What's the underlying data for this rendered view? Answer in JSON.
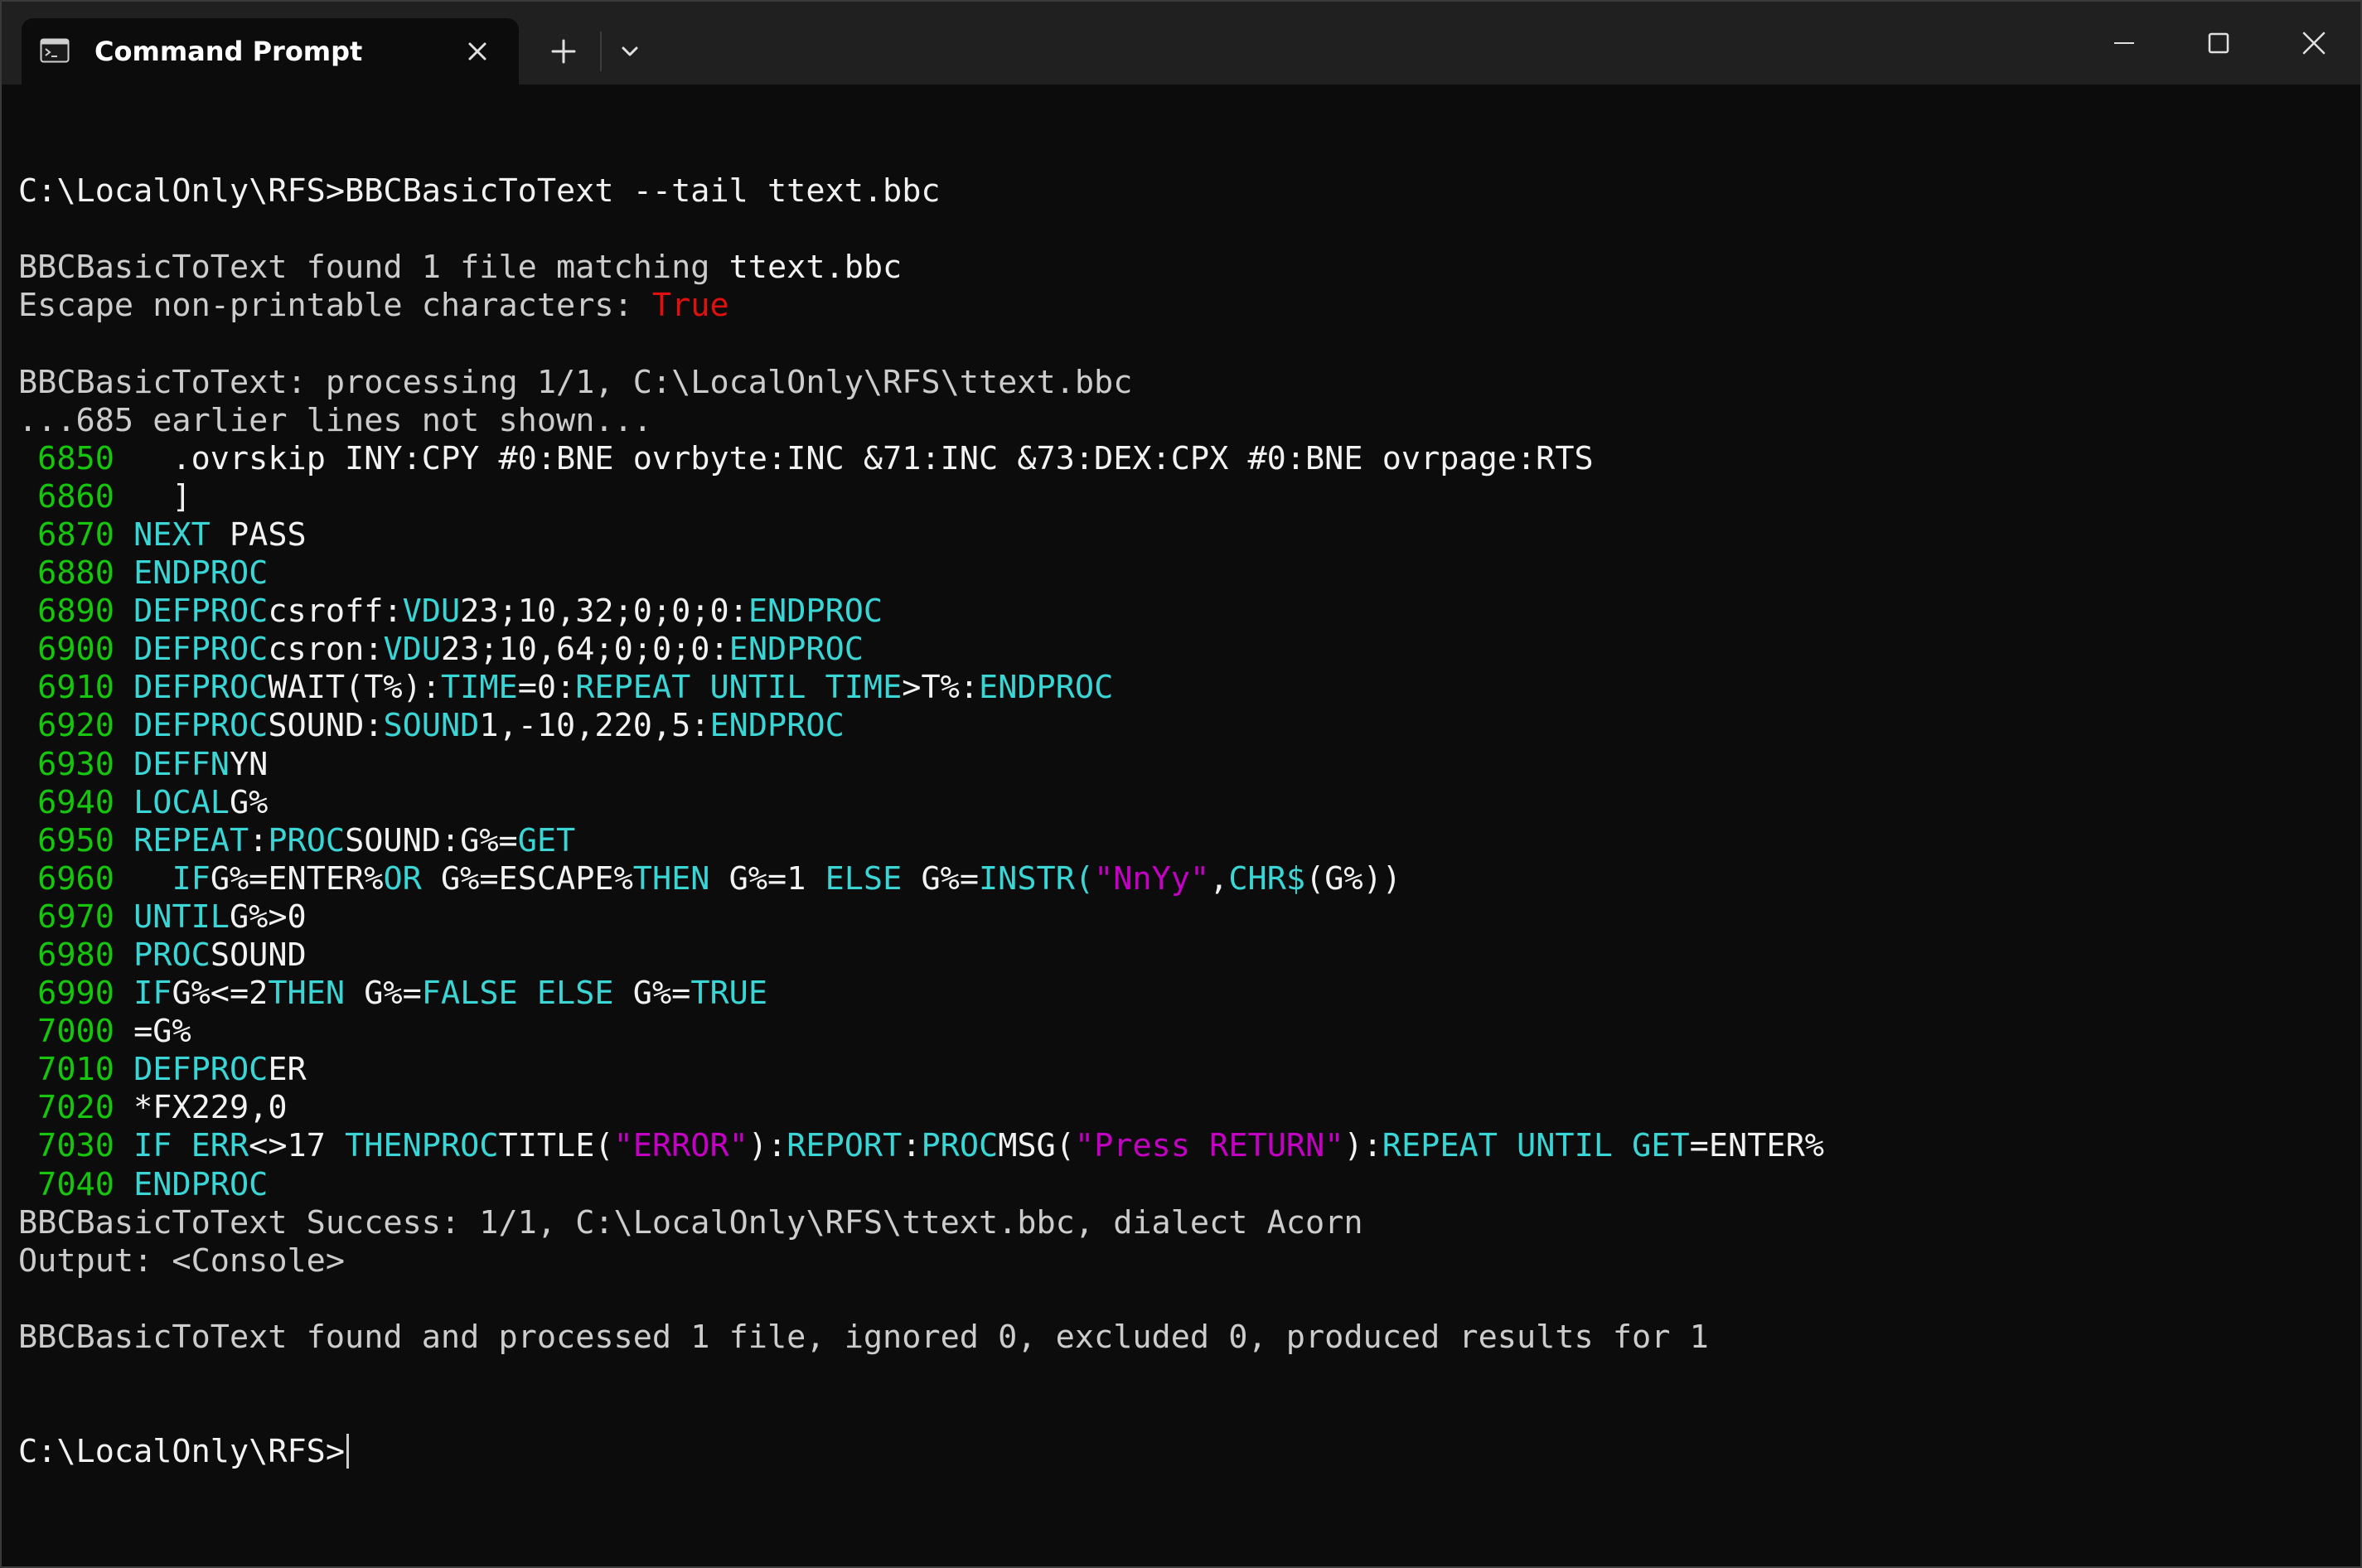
{
  "window": {
    "tab_title": "Command Prompt",
    "icons": {
      "tab": "terminal-icon",
      "close_tab": "close-icon",
      "new_tab": "plus-icon",
      "dropdown": "chevron-down-icon",
      "minimize": "minimize-icon",
      "maximize": "maximize-icon",
      "close_window": "close-icon"
    }
  },
  "colors": {
    "background": "#0c0c0c",
    "titlebar": "#202020",
    "default_text": "#cccccc",
    "bright_text": "#f2f2f2",
    "line_number": "#16c60c",
    "keyword": "#3ad6d6",
    "string": "#c400c4",
    "true_value": "#e01010"
  },
  "terminal": {
    "lines": [
      [
        {
          "t": ""
        }
      ],
      [
        {
          "t": "C:\\LocalOnly\\RFS>BBCBasicToText --tail ttext.bbc",
          "c": "wht"
        }
      ],
      [
        {
          "t": ""
        }
      ],
      [
        {
          "t": "BBCBasicToText found 1 file matching "
        },
        {
          "t": "ttext.bbc",
          "c": "wht"
        }
      ],
      [
        {
          "t": "Escape non-printable characters: "
        },
        {
          "t": "True",
          "c": "red"
        }
      ],
      [
        {
          "t": ""
        }
      ],
      [
        {
          "t": "BBCBasicToText: processing 1/1, C:\\LocalOnly\\RFS\\ttext.bbc"
        }
      ],
      [
        {
          "t": "...685 earlier lines not shown..."
        }
      ],
      [
        {
          "t": " 6850",
          "c": "num"
        },
        {
          "t": "   .ovrskip INY:CPY #0:BNE ovrbyte:INC &71:INC &73:DEX:CPX #0:BNE ovrpage:RTS",
          "c": "wht"
        }
      ],
      [
        {
          "t": " 6860",
          "c": "num"
        },
        {
          "t": "   ]",
          "c": "wht"
        }
      ],
      [
        {
          "t": " 6870",
          "c": "num"
        },
        {
          "t": " "
        },
        {
          "t": "NEXT",
          "c": "kw"
        },
        {
          "t": " PASS",
          "c": "wht"
        }
      ],
      [
        {
          "t": " 6880",
          "c": "num"
        },
        {
          "t": " "
        },
        {
          "t": "ENDPROC",
          "c": "kw"
        }
      ],
      [
        {
          "t": " 6890",
          "c": "num"
        },
        {
          "t": " "
        },
        {
          "t": "DEFPROC",
          "c": "kw"
        },
        {
          "t": "csroff:",
          "c": "wht"
        },
        {
          "t": "VDU",
          "c": "kw"
        },
        {
          "t": "23;10,32;0;0;0:",
          "c": "wht"
        },
        {
          "t": "ENDPROC",
          "c": "kw"
        }
      ],
      [
        {
          "t": " 6900",
          "c": "num"
        },
        {
          "t": " "
        },
        {
          "t": "DEFPROC",
          "c": "kw"
        },
        {
          "t": "csron:",
          "c": "wht"
        },
        {
          "t": "VDU",
          "c": "kw"
        },
        {
          "t": "23;10,64;0;0;0:",
          "c": "wht"
        },
        {
          "t": "ENDPROC",
          "c": "kw"
        }
      ],
      [
        {
          "t": " 6910",
          "c": "num"
        },
        {
          "t": " "
        },
        {
          "t": "DEFPROC",
          "c": "kw"
        },
        {
          "t": "WAIT(T%):",
          "c": "wht"
        },
        {
          "t": "TIME",
          "c": "kw"
        },
        {
          "t": "=0:",
          "c": "wht"
        },
        {
          "t": "REPEAT UNTIL TIME",
          "c": "kw"
        },
        {
          "t": ">T%:",
          "c": "wht"
        },
        {
          "t": "ENDPROC",
          "c": "kw"
        }
      ],
      [
        {
          "t": " 6920",
          "c": "num"
        },
        {
          "t": " "
        },
        {
          "t": "DEFPROC",
          "c": "kw"
        },
        {
          "t": "SOUND:",
          "c": "wht"
        },
        {
          "t": "SOUND",
          "c": "kw"
        },
        {
          "t": "1,-10,220,5:",
          "c": "wht"
        },
        {
          "t": "ENDPROC",
          "c": "kw"
        }
      ],
      [
        {
          "t": " 6930",
          "c": "num"
        },
        {
          "t": " "
        },
        {
          "t": "DEFFN",
          "c": "kw"
        },
        {
          "t": "YN",
          "c": "wht"
        }
      ],
      [
        {
          "t": " 6940",
          "c": "num"
        },
        {
          "t": " "
        },
        {
          "t": "LOCAL",
          "c": "kw"
        },
        {
          "t": "G%",
          "c": "wht"
        }
      ],
      [
        {
          "t": " 6950",
          "c": "num"
        },
        {
          "t": " "
        },
        {
          "t": "REPEAT",
          "c": "kw"
        },
        {
          "t": ":",
          "c": "wht"
        },
        {
          "t": "PROC",
          "c": "kw"
        },
        {
          "t": "SOUND:G%=",
          "c": "wht"
        },
        {
          "t": "GET",
          "c": "kw"
        }
      ],
      [
        {
          "t": " 6960",
          "c": "num"
        },
        {
          "t": "   "
        },
        {
          "t": "IF",
          "c": "kw"
        },
        {
          "t": "G%=ENTER%",
          "c": "wht"
        },
        {
          "t": "OR",
          "c": "kw"
        },
        {
          "t": " G%=ESCAPE%",
          "c": "wht"
        },
        {
          "t": "THEN",
          "c": "kw"
        },
        {
          "t": " G%=1 ",
          "c": "wht"
        },
        {
          "t": "ELSE",
          "c": "kw"
        },
        {
          "t": " G%=",
          "c": "wht"
        },
        {
          "t": "INSTR(",
          "c": "kw"
        },
        {
          "t": "\"NnYy\"",
          "c": "str"
        },
        {
          "t": ",",
          "c": "wht"
        },
        {
          "t": "CHR$",
          "c": "kw"
        },
        {
          "t": "(G%))",
          "c": "wht"
        }
      ],
      [
        {
          "t": " 6970",
          "c": "num"
        },
        {
          "t": " "
        },
        {
          "t": "UNTIL",
          "c": "kw"
        },
        {
          "t": "G%>0",
          "c": "wht"
        }
      ],
      [
        {
          "t": " 6980",
          "c": "num"
        },
        {
          "t": " "
        },
        {
          "t": "PROC",
          "c": "kw"
        },
        {
          "t": "SOUND",
          "c": "wht"
        }
      ],
      [
        {
          "t": " 6990",
          "c": "num"
        },
        {
          "t": " "
        },
        {
          "t": "IF",
          "c": "kw"
        },
        {
          "t": "G%<=2",
          "c": "wht"
        },
        {
          "t": "THEN",
          "c": "kw"
        },
        {
          "t": " G%=",
          "c": "wht"
        },
        {
          "t": "FALSE ELSE",
          "c": "kw"
        },
        {
          "t": " G%=",
          "c": "wht"
        },
        {
          "t": "TRUE",
          "c": "kw"
        }
      ],
      [
        {
          "t": " 7000",
          "c": "num"
        },
        {
          "t": " =G%",
          "c": "wht"
        }
      ],
      [
        {
          "t": " 7010",
          "c": "num"
        },
        {
          "t": " "
        },
        {
          "t": "DEFPROC",
          "c": "kw"
        },
        {
          "t": "ER",
          "c": "wht"
        }
      ],
      [
        {
          "t": " 7020",
          "c": "num"
        },
        {
          "t": " *FX229,0",
          "c": "wht"
        }
      ],
      [
        {
          "t": " 7030",
          "c": "num"
        },
        {
          "t": " "
        },
        {
          "t": "IF ERR",
          "c": "kw"
        },
        {
          "t": "<>17 ",
          "c": "wht"
        },
        {
          "t": "THENPROC",
          "c": "kw"
        },
        {
          "t": "TITLE(",
          "c": "wht"
        },
        {
          "t": "\"ERROR\"",
          "c": "str"
        },
        {
          "t": "):",
          "c": "wht"
        },
        {
          "t": "REPORT",
          "c": "kw"
        },
        {
          "t": ":",
          "c": "wht"
        },
        {
          "t": "PROC",
          "c": "kw"
        },
        {
          "t": "MSG(",
          "c": "wht"
        },
        {
          "t": "\"Press RETURN\"",
          "c": "str"
        },
        {
          "t": "):",
          "c": "wht"
        },
        {
          "t": "REPEAT UNTIL GET",
          "c": "kw"
        },
        {
          "t": "=ENTER%",
          "c": "wht"
        }
      ],
      [
        {
          "t": " 7040",
          "c": "num"
        },
        {
          "t": " "
        },
        {
          "t": "ENDPROC",
          "c": "kw"
        }
      ],
      [
        {
          "t": "BBCBasicToText Success: 1/1, C:\\LocalOnly\\RFS\\ttext.bbc, dialect Acorn"
        }
      ],
      [
        {
          "t": "Output: <Console>"
        }
      ],
      [
        {
          "t": ""
        }
      ],
      [
        {
          "t": "BBCBasicToText found and processed 1 file, ignored 0, excluded 0, produced results for 1"
        }
      ],
      [
        {
          "t": ""
        }
      ],
      [
        {
          "t": ""
        }
      ],
      [
        {
          "t": "C:\\LocalOnly\\RFS>",
          "c": "wht",
          "cursor": true
        }
      ]
    ]
  }
}
